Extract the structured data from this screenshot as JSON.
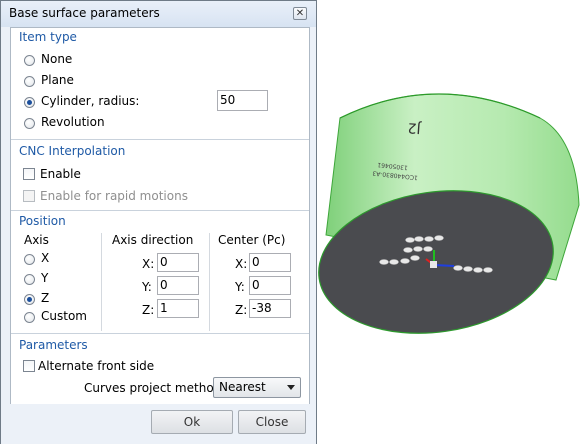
{
  "dialog": {
    "title": "Base surface parameters",
    "close_glyph": "✕"
  },
  "item_type": {
    "title": "Item type",
    "options": [
      "None",
      "Plane",
      "Cylinder, radius:",
      "Revolution"
    ],
    "selected": "Cylinder, radius:",
    "radius_value": "50"
  },
  "cnc": {
    "title": "CNC Interpolation",
    "enable_label": "Enable",
    "enable_checked": false,
    "rapid_label": "Enable for rapid motions",
    "rapid_checked": false
  },
  "position": {
    "title": "Position",
    "axis_header": "Axis",
    "axis_options": [
      "X",
      "Y",
      "Z",
      "Custom"
    ],
    "axis_selected": "Z",
    "direction_header": "Axis direction",
    "direction": {
      "x_label": "X:",
      "x": "0",
      "y_label": "Y:",
      "y": "0",
      "z_label": "Z:",
      "z": "1"
    },
    "center_header": "Center (Pc)",
    "center": {
      "x_label": "X:",
      "x": "0",
      "y_label": "Y:",
      "y": "0",
      "z_label": "Z:",
      "z": "-38"
    }
  },
  "parameters": {
    "title": "Parameters",
    "alternate_label": "Alternate front side",
    "alternate_checked": false,
    "curves_label": "Curves project method:",
    "curves_value": "Nearest"
  },
  "buttons": {
    "ok": "Ok",
    "close": "Close"
  },
  "viewport": {
    "engraving_top": "J2",
    "engraving_small_1": "1CO440830-A3",
    "engraving_small_2": "13050461",
    "colors": {
      "cylinder": "#a8e6a3",
      "bottom_face": "#4a4b4f",
      "edge": "#2d9a2d"
    }
  }
}
